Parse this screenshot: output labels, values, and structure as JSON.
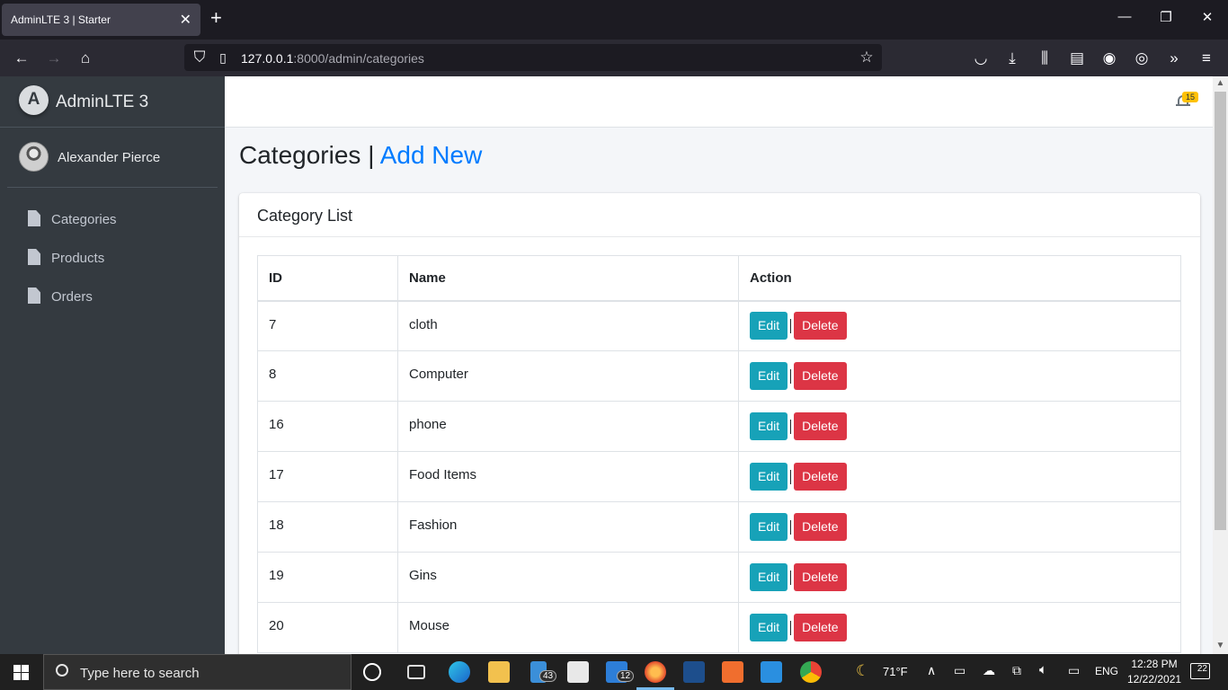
{
  "browser": {
    "tab_title": "AdminLTE 3 | Starter",
    "tab_close": "✕",
    "new_tab": "+",
    "url_host": "127.0.0.1",
    "url_rest": ":8000/admin/categories"
  },
  "sidebar": {
    "brand": "AdminLTE 3",
    "user_name": "Alexander Pierce",
    "items": [
      {
        "label": "Categories"
      },
      {
        "label": "Products"
      },
      {
        "label": "Orders"
      }
    ]
  },
  "topbar": {
    "notification_count": "15"
  },
  "page": {
    "title": "Categories",
    "separator": "|",
    "add_new": "Add New"
  },
  "card": {
    "title": "Category List",
    "columns": [
      "ID",
      "Name",
      "Action"
    ],
    "edit_label": "Edit",
    "delete_label": "Delete",
    "rows": [
      {
        "id": "7",
        "name": "cloth"
      },
      {
        "id": "8",
        "name": "Computer"
      },
      {
        "id": "16",
        "name": "phone"
      },
      {
        "id": "17",
        "name": "Food Items"
      },
      {
        "id": "18",
        "name": "Fashion"
      },
      {
        "id": "19",
        "name": "Gins"
      },
      {
        "id": "20",
        "name": "Mouse"
      }
    ]
  },
  "taskbar": {
    "search_placeholder": "Type here to search",
    "mail_badge": "43",
    "outlook_badge": "12",
    "weather": "71°F",
    "language": "ENG",
    "time": "12:28 PM",
    "date": "12/22/2021",
    "notifications": "22"
  },
  "colors": {
    "sidebar": "#343a40",
    "primary_link": "#007bff",
    "edit": "#17a2b8",
    "delete": "#dc3545",
    "badge": "#ffc107"
  }
}
